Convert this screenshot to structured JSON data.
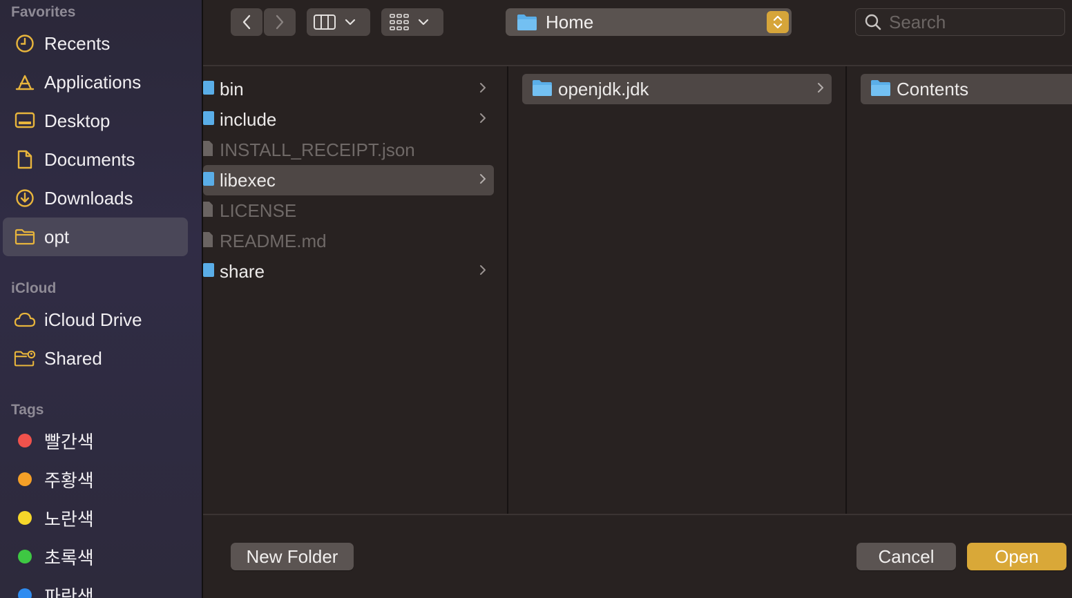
{
  "sidebar": {
    "favorites_title": "Favorites",
    "favorites": [
      {
        "label": "Recents",
        "icon": "clock-icon"
      },
      {
        "label": "Applications",
        "icon": "applications-icon"
      },
      {
        "label": "Desktop",
        "icon": "desktop-icon"
      },
      {
        "label": "Documents",
        "icon": "document-icon"
      },
      {
        "label": "Downloads",
        "icon": "download-icon"
      },
      {
        "label": "opt",
        "icon": "folder-icon",
        "selected": true
      }
    ],
    "icloud_title": "iCloud",
    "icloud": [
      {
        "label": "iCloud Drive",
        "icon": "cloud-icon"
      },
      {
        "label": "Shared",
        "icon": "shared-folder-icon"
      }
    ],
    "tags_title": "Tags",
    "tags": [
      {
        "label": "빨간색",
        "color": "#f0524c"
      },
      {
        "label": "주황색",
        "color": "#f5a027"
      },
      {
        "label": "노란색",
        "color": "#f6d72a"
      },
      {
        "label": "초록색",
        "color": "#3ec843"
      },
      {
        "label": "파란색",
        "color": "#2f8cf0"
      }
    ]
  },
  "toolbar": {
    "path_label": "Home",
    "search_placeholder": "Search"
  },
  "columns": {
    "col1": [
      {
        "name": "bin",
        "kind": "folder",
        "has_children": true
      },
      {
        "name": "include",
        "kind": "folder",
        "has_children": true
      },
      {
        "name": "INSTALL_RECEIPT.json",
        "kind": "file",
        "dimmed": true
      },
      {
        "name": "libexec",
        "kind": "folder",
        "has_children": true,
        "selected": true
      },
      {
        "name": "LICENSE",
        "kind": "file",
        "dimmed": true
      },
      {
        "name": "README.md",
        "kind": "file",
        "dimmed": true
      },
      {
        "name": "share",
        "kind": "folder",
        "has_children": true
      }
    ],
    "col2": [
      {
        "name": "openjdk.jdk",
        "kind": "folder",
        "has_children": true,
        "selected": true
      }
    ],
    "col3": [
      {
        "name": "Contents",
        "kind": "folder",
        "selected": true
      }
    ]
  },
  "buttons": {
    "new_folder": "New Folder",
    "cancel": "Cancel",
    "open": "Open"
  },
  "colors": {
    "accent": "#d9a838",
    "folder_blue": "#5aaee8"
  }
}
